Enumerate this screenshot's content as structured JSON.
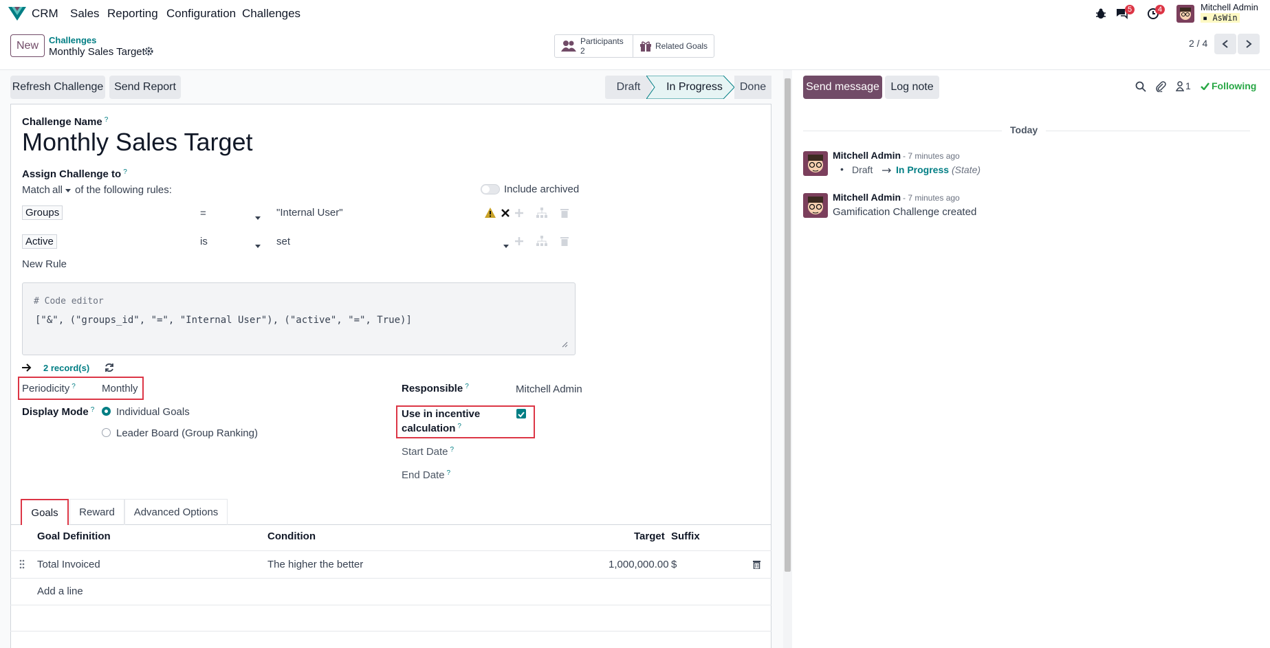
{
  "navbar": {
    "app_name": "CRM",
    "menu": [
      "Sales",
      "Reporting",
      "Configuration",
      "Challenges"
    ],
    "messages_count": "5",
    "activities_count": "4",
    "user_name": "Mitchell Admin",
    "user_db": "AsWin"
  },
  "control_panel": {
    "new_label": "New",
    "breadcrumb_parent": "Challenges",
    "record_title": "Monthly Sales Target",
    "participants_label": "Participants",
    "participants_count": "2",
    "related_goals_label": "Related Goals",
    "pager": "2 / 4"
  },
  "actions": {
    "refresh": "Refresh Challenge",
    "send_report": "Send Report"
  },
  "status": {
    "draft": "Draft",
    "in_progress": "In Progress",
    "done": "Done",
    "active": "In Progress"
  },
  "form": {
    "challenge_name_label": "Challenge Name",
    "challenge_name": "Monthly Sales Target",
    "assign_label": "Assign Challenge to",
    "match_prefix": "Match",
    "match_value": "all",
    "match_suffix": "of the following rules:",
    "include_archived": "Include archived",
    "rules": [
      {
        "field": "Groups",
        "operator": "=",
        "value": "\"Internal User\""
      },
      {
        "field": "Active",
        "operator": "is",
        "value": "set"
      }
    ],
    "new_rule": "New Rule",
    "code_comment": "# Code editor",
    "code_domain": "[\"&\", (\"groups_id\", \"=\", \"Internal User\"), (\"active\", \"=\", True)]",
    "records_count": "2 record(s)",
    "periodicity_label": "Periodicity",
    "periodicity_value": "Monthly",
    "display_mode_label": "Display Mode",
    "display_options": [
      "Individual Goals",
      "Leader Board (Group Ranking)"
    ],
    "display_selected": "Individual Goals",
    "responsible_label": "Responsible",
    "responsible_value": "Mitchell Admin",
    "incentive_label_1": "Use in incentive",
    "incentive_label_2": "calculation",
    "incentive_checked": true,
    "start_date_label": "Start Date",
    "end_date_label": "End Date"
  },
  "tabs": [
    "Goals",
    "Reward",
    "Advanced Options"
  ],
  "active_tab": "Goals",
  "goals_table": {
    "columns": [
      "Goal Definition",
      "Condition",
      "Target",
      "Suffix"
    ],
    "rows": [
      {
        "definition": "Total Invoiced",
        "condition": "The higher the better",
        "target": "1,000,000.00",
        "suffix": "$"
      }
    ],
    "add_line": "Add a line"
  },
  "chatter": {
    "send_message": "Send message",
    "log_note": "Log note",
    "followers_count": "1",
    "following": "Following",
    "date_separator": "Today",
    "messages": [
      {
        "author": "Mitchell Admin",
        "time": "- 7 minutes ago",
        "from": "Draft",
        "to": "In Progress",
        "field": "(State)"
      },
      {
        "author": "Mitchell Admin",
        "time": "- 7 minutes ago",
        "body": "Gamification Challenge created"
      }
    ]
  },
  "colors": {
    "brand": "#714b67",
    "teal": "#017e84",
    "highlight": "#dc3545",
    "following": "#28a745"
  }
}
